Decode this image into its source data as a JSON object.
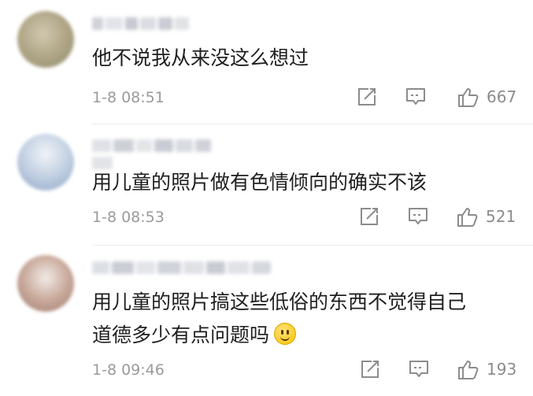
{
  "comments": [
    {
      "text": "他不说我从来没这么想过",
      "time": "1-8 08:51",
      "likes": "667",
      "icons": [
        "share-icon",
        "comment-icon",
        "thumbs-up-icon"
      ],
      "avatar_colors": [
        "#d2c8b0",
        "#8f8a6a"
      ]
    },
    {
      "text": "用儿童的照片做有色情倾向的确实不该",
      "time": "1-8 08:53",
      "likes": "521",
      "icons": [
        "share-icon",
        "comment-icon",
        "thumbs-up-icon"
      ],
      "avatar_colors": [
        "#dfe6ef",
        "#8fa6c4"
      ]
    },
    {
      "text_line1": "用儿童的照片搞这些低俗的东西不觉得自己",
      "text_line2": "道德多少有点问题吗",
      "emoji": "smiling-face-emoji",
      "time": "1-8 09:46",
      "likes": "193",
      "icons": [
        "share-icon",
        "comment-icon",
        "thumbs-up-icon"
      ],
      "avatar_colors": [
        "#e8dcd6",
        "#a07a6c"
      ]
    }
  ],
  "colors": {
    "text": "#1f1f1f",
    "meta": "#9a9a9a",
    "icon": "#8c8c8c",
    "divider": "#ececec"
  }
}
